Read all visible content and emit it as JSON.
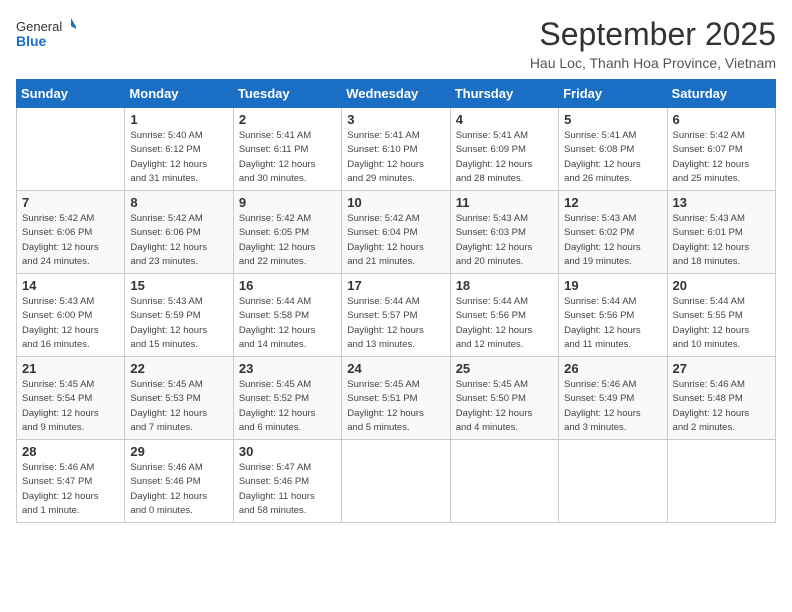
{
  "header": {
    "logo_general": "General",
    "logo_blue": "Blue",
    "title": "September 2025",
    "location": "Hau Loc, Thanh Hoa Province, Vietnam"
  },
  "weekdays": [
    "Sunday",
    "Monday",
    "Tuesday",
    "Wednesday",
    "Thursday",
    "Friday",
    "Saturday"
  ],
  "weeks": [
    [
      {
        "day": null
      },
      {
        "day": "1",
        "sunrise": "5:40 AM",
        "sunset": "6:12 PM",
        "daylight": "12 hours and 31 minutes."
      },
      {
        "day": "2",
        "sunrise": "5:41 AM",
        "sunset": "6:11 PM",
        "daylight": "12 hours and 30 minutes."
      },
      {
        "day": "3",
        "sunrise": "5:41 AM",
        "sunset": "6:10 PM",
        "daylight": "12 hours and 29 minutes."
      },
      {
        "day": "4",
        "sunrise": "5:41 AM",
        "sunset": "6:09 PM",
        "daylight": "12 hours and 28 minutes."
      },
      {
        "day": "5",
        "sunrise": "5:41 AM",
        "sunset": "6:08 PM",
        "daylight": "12 hours and 26 minutes."
      },
      {
        "day": "6",
        "sunrise": "5:42 AM",
        "sunset": "6:07 PM",
        "daylight": "12 hours and 25 minutes."
      }
    ],
    [
      {
        "day": "7",
        "sunrise": "5:42 AM",
        "sunset": "6:06 PM",
        "daylight": "12 hours and 24 minutes."
      },
      {
        "day": "8",
        "sunrise": "5:42 AM",
        "sunset": "6:06 PM",
        "daylight": "12 hours and 23 minutes."
      },
      {
        "day": "9",
        "sunrise": "5:42 AM",
        "sunset": "6:05 PM",
        "daylight": "12 hours and 22 minutes."
      },
      {
        "day": "10",
        "sunrise": "5:42 AM",
        "sunset": "6:04 PM",
        "daylight": "12 hours and 21 minutes."
      },
      {
        "day": "11",
        "sunrise": "5:43 AM",
        "sunset": "6:03 PM",
        "daylight": "12 hours and 20 minutes."
      },
      {
        "day": "12",
        "sunrise": "5:43 AM",
        "sunset": "6:02 PM",
        "daylight": "12 hours and 19 minutes."
      },
      {
        "day": "13",
        "sunrise": "5:43 AM",
        "sunset": "6:01 PM",
        "daylight": "12 hours and 18 minutes."
      }
    ],
    [
      {
        "day": "14",
        "sunrise": "5:43 AM",
        "sunset": "6:00 PM",
        "daylight": "12 hours and 16 minutes."
      },
      {
        "day": "15",
        "sunrise": "5:43 AM",
        "sunset": "5:59 PM",
        "daylight": "12 hours and 15 minutes."
      },
      {
        "day": "16",
        "sunrise": "5:44 AM",
        "sunset": "5:58 PM",
        "daylight": "12 hours and 14 minutes."
      },
      {
        "day": "17",
        "sunrise": "5:44 AM",
        "sunset": "5:57 PM",
        "daylight": "12 hours and 13 minutes."
      },
      {
        "day": "18",
        "sunrise": "5:44 AM",
        "sunset": "5:56 PM",
        "daylight": "12 hours and 12 minutes."
      },
      {
        "day": "19",
        "sunrise": "5:44 AM",
        "sunset": "5:56 PM",
        "daylight": "12 hours and 11 minutes."
      },
      {
        "day": "20",
        "sunrise": "5:44 AM",
        "sunset": "5:55 PM",
        "daylight": "12 hours and 10 minutes."
      }
    ],
    [
      {
        "day": "21",
        "sunrise": "5:45 AM",
        "sunset": "5:54 PM",
        "daylight": "12 hours and 9 minutes."
      },
      {
        "day": "22",
        "sunrise": "5:45 AM",
        "sunset": "5:53 PM",
        "daylight": "12 hours and 7 minutes."
      },
      {
        "day": "23",
        "sunrise": "5:45 AM",
        "sunset": "5:52 PM",
        "daylight": "12 hours and 6 minutes."
      },
      {
        "day": "24",
        "sunrise": "5:45 AM",
        "sunset": "5:51 PM",
        "daylight": "12 hours and 5 minutes."
      },
      {
        "day": "25",
        "sunrise": "5:45 AM",
        "sunset": "5:50 PM",
        "daylight": "12 hours and 4 minutes."
      },
      {
        "day": "26",
        "sunrise": "5:46 AM",
        "sunset": "5:49 PM",
        "daylight": "12 hours and 3 minutes."
      },
      {
        "day": "27",
        "sunrise": "5:46 AM",
        "sunset": "5:48 PM",
        "daylight": "12 hours and 2 minutes."
      }
    ],
    [
      {
        "day": "28",
        "sunrise": "5:46 AM",
        "sunset": "5:47 PM",
        "daylight": "12 hours and 1 minute."
      },
      {
        "day": "29",
        "sunrise": "5:46 AM",
        "sunset": "5:46 PM",
        "daylight": "12 hours and 0 minutes."
      },
      {
        "day": "30",
        "sunrise": "5:47 AM",
        "sunset": "5:46 PM",
        "daylight": "11 hours and 58 minutes."
      },
      {
        "day": null
      },
      {
        "day": null
      },
      {
        "day": null
      },
      {
        "day": null
      }
    ]
  ],
  "labels": {
    "sunrise": "Sunrise:",
    "sunset": "Sunset:",
    "daylight": "Daylight hours"
  }
}
